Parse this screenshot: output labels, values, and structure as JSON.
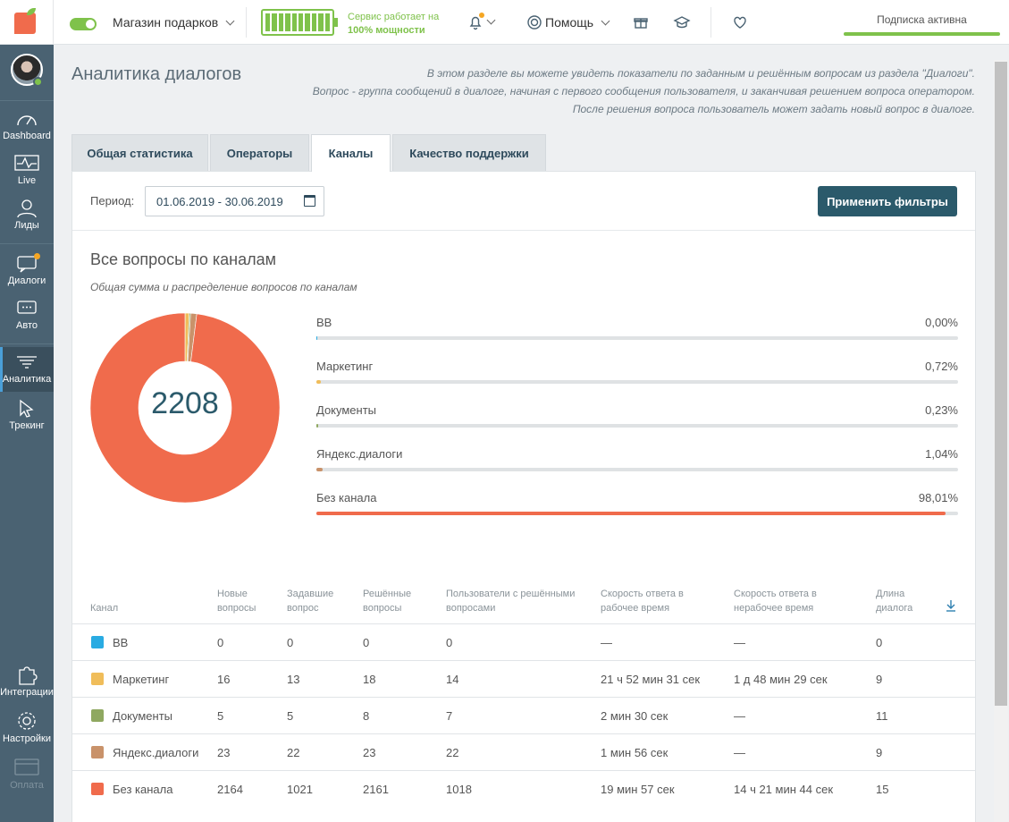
{
  "topbar": {
    "shop_name": "Магазин подарков",
    "service_line1": "Сервис работает на",
    "service_line2": "100% мощности",
    "battery_level": 1.0,
    "help_label": "Помощь",
    "subscription": "Подписка активна",
    "colors": {
      "brand_orange": "#f06b4c",
      "green": "#7fc24b"
    }
  },
  "sidebar": {
    "items": [
      {
        "label": "Dashboard",
        "icon": "speedometer-icon"
      },
      {
        "label": "Live",
        "icon": "pulse-icon"
      },
      {
        "label": "Лиды",
        "icon": "users-icon"
      },
      {
        "label": "Диалоги",
        "icon": "chat-icon",
        "badge": true
      },
      {
        "label": "Авто",
        "icon": "chat-auto-icon"
      },
      {
        "label": "Аналитика",
        "icon": "funnel-icon",
        "active": true
      },
      {
        "label": "Трекинг",
        "icon": "cursor-icon"
      },
      {
        "label": "Интеграции",
        "icon": "puzzle-icon"
      },
      {
        "label": "Настройки",
        "icon": "gear-icon"
      },
      {
        "label": "Оплата",
        "icon": "card-icon",
        "disabled": true
      }
    ]
  },
  "page": {
    "title": "Аналитика диалогов",
    "desc1": "В этом разделе вы можете увидеть показатели по заданным и решённым вопросам из раздела \"Диалоги\".",
    "desc2": "Вопрос - группа сообщений в диалоге, начиная с первого сообщения пользователя, и заканчивая решением вопроса оператором.",
    "desc3": "После решения вопроса пользователь может задать новый вопрос в диалоге."
  },
  "tabs": [
    {
      "label": "Общая статистика"
    },
    {
      "label": "Операторы"
    },
    {
      "label": "Каналы",
      "active": true
    },
    {
      "label": "Качество поддержки"
    }
  ],
  "filters": {
    "period_label": "Период:",
    "period_value": "01.06.2019 - 30.06.2019",
    "apply_label": "Применить фильтры"
  },
  "section": {
    "title": "Все вопросы по каналам",
    "subtitle": "Общая сумма и распределение вопросов по каналам",
    "total": "2208"
  },
  "chart_data": {
    "type": "pie",
    "categories": [
      "BB",
      "Маркетинг",
      "Документы",
      "Яндекс.диалоги",
      "Без канала"
    ],
    "values": [
      0.0,
      0.72,
      0.23,
      1.04,
      98.01
    ],
    "value_labels": [
      "0,00%",
      "0,72%",
      "0,23%",
      "1,04%",
      "98,01%"
    ],
    "colors": [
      "#29abe2",
      "#f0bd5a",
      "#8fa860",
      "#c9926a",
      "#f06b4c"
    ],
    "center_label": "2208"
  },
  "table": {
    "headers": [
      [
        "Канал"
      ],
      [
        "Новые",
        "вопросы"
      ],
      [
        "Задавшие",
        "вопрос"
      ],
      [
        "Решённые",
        "вопросы"
      ],
      [
        "Пользователи с решёнными",
        "вопросами"
      ],
      [
        "Скорость ответа в",
        "рабочее время"
      ],
      [
        "Скорость ответа в",
        "нерабочее время"
      ],
      [
        "Длина",
        "диалога"
      ]
    ],
    "rows": [
      {
        "channel": "BB",
        "color": "#29abe2",
        "new": "0",
        "asked": "0",
        "solved": "0",
        "users": "0",
        "work": "—",
        "nonwork": "—",
        "length": "0"
      },
      {
        "channel": "Маркетинг",
        "color": "#f0bd5a",
        "new": "16",
        "asked": "13",
        "solved": "18",
        "users": "14",
        "work": "21 ч 52 мин 31 сек",
        "nonwork": "1 д 48 мин 29 сек",
        "length": "9"
      },
      {
        "channel": "Документы",
        "color": "#8fa860",
        "new": "5",
        "asked": "5",
        "solved": "8",
        "users": "7",
        "work": "2 мин 30 сек",
        "nonwork": "—",
        "length": "11"
      },
      {
        "channel": "Яндекс.диалоги",
        "color": "#c9926a",
        "new": "23",
        "asked": "22",
        "solved": "23",
        "users": "22",
        "work": "1 мин 56 сек",
        "nonwork": "—",
        "length": "9"
      },
      {
        "channel": "Без канала",
        "color": "#f06b4c",
        "new": "2164",
        "asked": "1021",
        "solved": "2161",
        "users": "1018",
        "work": "19 мин 57 сек",
        "nonwork": "14 ч 21 мин 44 сек",
        "length": "15"
      }
    ]
  }
}
